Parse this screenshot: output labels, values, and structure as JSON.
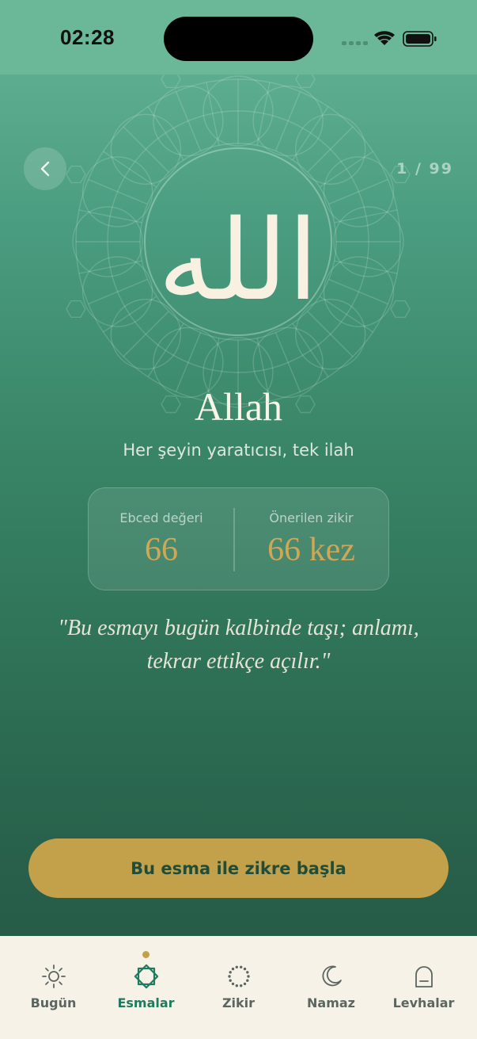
{
  "status_bar": {
    "time": "02:28"
  },
  "header": {
    "counter": "1 / 99"
  },
  "name": {
    "arabic": "الله",
    "title": "Allah",
    "meaning": "Her şeyin yaratıcısı, tek ilah"
  },
  "info_card": {
    "ebced_label": "Ebced değeri",
    "ebced_value": "66",
    "zikir_label": "Önerilen zikir",
    "zikir_value": "66 kez"
  },
  "quote": {
    "line1": "\"Bu esmayı bugün kalbinde taşı; anlamı,",
    "line2": "tekrar ettikçe açılır.\""
  },
  "cta": {
    "label": "Bu esma ile zikre başla"
  },
  "tabs": [
    {
      "label": "Bugün",
      "icon": "sun-icon",
      "active": false
    },
    {
      "label": "Esmalar",
      "icon": "star-octagon-icon",
      "active": true
    },
    {
      "label": "Zikir",
      "icon": "prayer-beads-icon",
      "active": false
    },
    {
      "label": "Namaz",
      "icon": "moon-icon",
      "active": false
    },
    {
      "label": "Levhalar",
      "icon": "frame-arch-icon",
      "active": false
    }
  ],
  "colors": {
    "accent_gold": "#c3a14b",
    "active_tab": "#1f7a5f",
    "inactive_tab": "#5b6660",
    "tab_bar_bg": "#f7f2e8",
    "gradient_top": "#66b597",
    "gradient_bottom": "#235645"
  }
}
